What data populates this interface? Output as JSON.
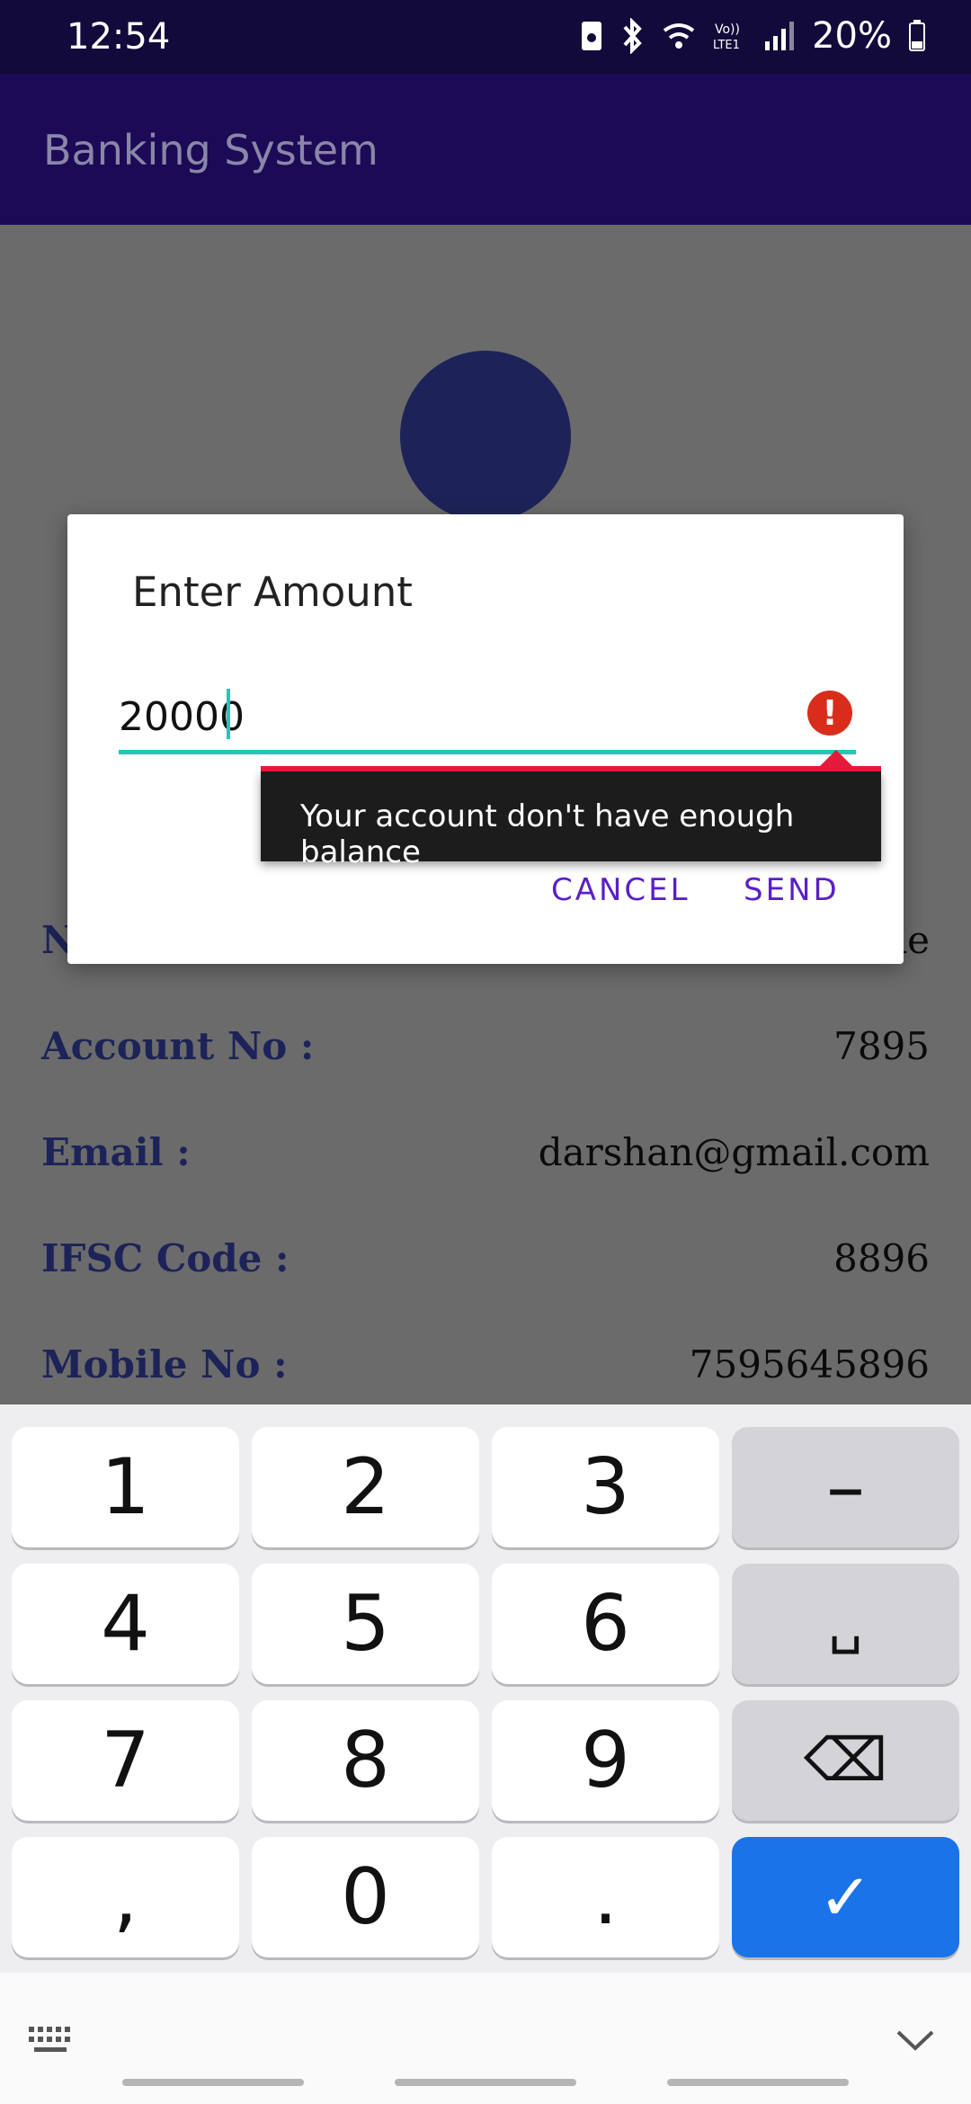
{
  "status_bar": {
    "time": "12:54",
    "battery": "20%",
    "icons": [
      "sim-icon",
      "bluetooth-icon",
      "wifi-icon",
      "volte-icon",
      "signal-icon",
      "battery-icon"
    ]
  },
  "app_bar": {
    "title": "Banking System"
  },
  "details": [
    {
      "label": "Account No :",
      "value": "7895"
    },
    {
      "label": "Email :",
      "value": "darshan@gmail.com"
    },
    {
      "label": "IFSC Code :",
      "value": "8896"
    },
    {
      "label": "Mobile No :",
      "value": "7595645896"
    }
  ],
  "partial_row": {
    "label": "N",
    "value": "ie"
  },
  "dialog": {
    "title": "Enter Amount",
    "amount_value": "20000",
    "error": "Your account don't have enough balance",
    "cancel_label": "CANCEL",
    "send_label": "SEND"
  },
  "keyboard": {
    "keys": [
      "1",
      "2",
      "3",
      "–",
      "4",
      "5",
      "6",
      "␣",
      "7",
      "8",
      "9",
      "⌫",
      ",",
      "0",
      ".",
      "✓"
    ]
  },
  "colors": {
    "status_bar": "#110a3a",
    "app_bar": "#1c0a56",
    "accent_teal": "#23c7b6",
    "button_purple": "#5a1fc7",
    "error_red": "#d92d1b",
    "enter_key": "#1a73e8"
  }
}
